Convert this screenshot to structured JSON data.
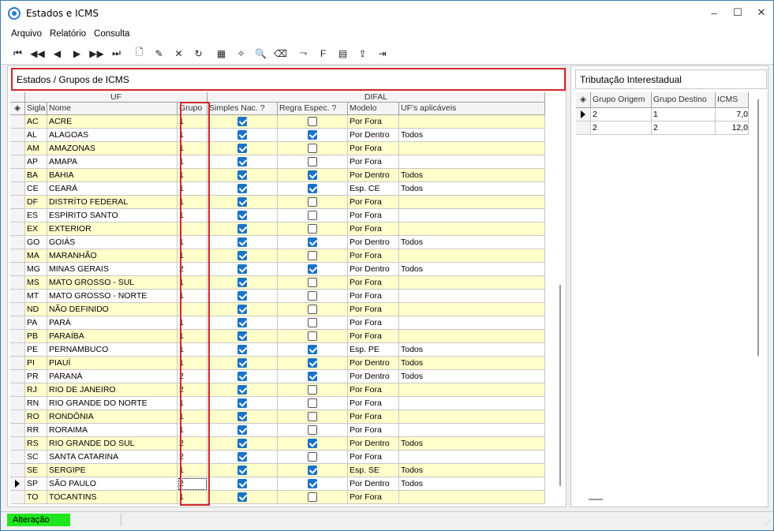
{
  "window": {
    "title": "Estados e ICMS",
    "minimize": "–",
    "maximize": "☐",
    "close": "✕"
  },
  "menu": [
    "Arquivo",
    "Relatório",
    "Consulta"
  ],
  "toolbar": [
    "first-icon",
    "prior-page-icon",
    "prior-icon",
    "next-icon",
    "next-page-icon",
    "last-icon",
    "new-document-icon",
    "edit-icon",
    "delete-icon",
    "refresh-icon",
    "print-setup-icon",
    "magic-wand-icon",
    "print-preview-icon",
    "eraser-icon",
    "goto-icon",
    "filter-icon",
    "report-icon",
    "export-icon",
    "exit-icon"
  ],
  "toolbar_glyphs": [
    "⏮",
    "◀◀",
    "◀",
    "▶",
    "▶▶",
    "⏭",
    "🗋",
    "✎",
    "✕",
    "↻",
    "▦",
    "✧",
    "🔍",
    "⌫",
    "⤳",
    "F",
    "▤",
    "⇪",
    "⇥"
  ],
  "left_panel": {
    "title": "Estados / Grupos de ICMS"
  },
  "grid": {
    "band_uf": "UF",
    "band_difal": "DIFAL",
    "columns": [
      "Sigla",
      "Nome",
      "Grupo",
      "Simples Nac. ?",
      "Regra Espec. ?",
      "Modelo",
      "UF's aplicáveis"
    ],
    "rows": [
      {
        "sigla": "AC",
        "nome": "ACRE",
        "grupo": "1",
        "simples": true,
        "regra": false,
        "modelo": "Por Fora",
        "ufs": ""
      },
      {
        "sigla": "AL",
        "nome": "ALAGOAS",
        "grupo": "1",
        "simples": true,
        "regra": true,
        "modelo": "Por Dentro",
        "ufs": "Todos"
      },
      {
        "sigla": "AM",
        "nome": "AMAZONAS",
        "grupo": "1",
        "simples": true,
        "regra": false,
        "modelo": "Por Fora",
        "ufs": ""
      },
      {
        "sigla": "AP",
        "nome": "AMAPA",
        "grupo": "1",
        "simples": true,
        "regra": false,
        "modelo": "Por Fora",
        "ufs": ""
      },
      {
        "sigla": "BA",
        "nome": "BAHIA",
        "grupo": "1",
        "simples": true,
        "regra": true,
        "modelo": "Por Dentro",
        "ufs": "Todos"
      },
      {
        "sigla": "CE",
        "nome": "CEARÁ",
        "grupo": "1",
        "simples": true,
        "regra": true,
        "modelo": "Esp. CE",
        "ufs": "Todos"
      },
      {
        "sigla": "DF",
        "nome": "DISTRÍTO FEDERAL",
        "grupo": "1",
        "simples": true,
        "regra": false,
        "modelo": "Por Fora",
        "ufs": ""
      },
      {
        "sigla": "ES",
        "nome": "ESPÍRITO SANTO",
        "grupo": "1",
        "simples": true,
        "regra": false,
        "modelo": "Por Fora",
        "ufs": ""
      },
      {
        "sigla": "EX",
        "nome": "EXTERIOR",
        "grupo": "",
        "simples": true,
        "regra": false,
        "modelo": "Por Fora",
        "ufs": ""
      },
      {
        "sigla": "GO",
        "nome": "GOIÁS",
        "grupo": "1",
        "simples": true,
        "regra": true,
        "modelo": "Por Dentro",
        "ufs": "Todos"
      },
      {
        "sigla": "MA",
        "nome": "MARANHÃO",
        "grupo": "1",
        "simples": true,
        "regra": false,
        "modelo": "Por Fora",
        "ufs": ""
      },
      {
        "sigla": "MG",
        "nome": "MINAS GERAIS",
        "grupo": "2",
        "simples": true,
        "regra": true,
        "modelo": "Por Dentro",
        "ufs": "Todos"
      },
      {
        "sigla": "MS",
        "nome": "MATO GROSSO - SUL",
        "grupo": "1",
        "simples": true,
        "regra": false,
        "modelo": "Por Fora",
        "ufs": ""
      },
      {
        "sigla": "MT",
        "nome": "MATO GROSSO - NORTE",
        "grupo": "1",
        "simples": true,
        "regra": false,
        "modelo": "Por Fora",
        "ufs": ""
      },
      {
        "sigla": "ND",
        "nome": "NÃO DEFINIDO",
        "grupo": "",
        "simples": true,
        "regra": false,
        "modelo": "Por Fora",
        "ufs": ""
      },
      {
        "sigla": "PA",
        "nome": "PARÁ",
        "grupo": "1",
        "simples": true,
        "regra": false,
        "modelo": "Por Fora",
        "ufs": ""
      },
      {
        "sigla": "PB",
        "nome": "PARAÍBA",
        "grupo": "1",
        "simples": true,
        "regra": false,
        "modelo": "Por Fora",
        "ufs": ""
      },
      {
        "sigla": "PE",
        "nome": "PERNAMBUCO",
        "grupo": "1",
        "simples": true,
        "regra": true,
        "modelo": "Esp. PE",
        "ufs": "Todos"
      },
      {
        "sigla": "PI",
        "nome": "PIAUÍ",
        "grupo": "1",
        "simples": true,
        "regra": true,
        "modelo": "Por Dentro",
        "ufs": "Todos"
      },
      {
        "sigla": "PR",
        "nome": "PARANÁ",
        "grupo": "2",
        "simples": true,
        "regra": true,
        "modelo": "Por Dentro",
        "ufs": "Todos"
      },
      {
        "sigla": "RJ",
        "nome": "RIO DE JANEIRO",
        "grupo": "2",
        "simples": true,
        "regra": false,
        "modelo": "Por Fora",
        "ufs": ""
      },
      {
        "sigla": "RN",
        "nome": "RIO GRANDE DO NORTE",
        "grupo": "1",
        "simples": true,
        "regra": false,
        "modelo": "Por Fora",
        "ufs": ""
      },
      {
        "sigla": "RO",
        "nome": "RONDÔNIA",
        "grupo": "1",
        "simples": true,
        "regra": false,
        "modelo": "Por Fora",
        "ufs": ""
      },
      {
        "sigla": "RR",
        "nome": "RORAIMA",
        "grupo": "1",
        "simples": true,
        "regra": false,
        "modelo": "Por Fora",
        "ufs": ""
      },
      {
        "sigla": "RS",
        "nome": "RIO GRANDE DO SUL",
        "grupo": "2",
        "simples": true,
        "regra": true,
        "modelo": "Por Dentro",
        "ufs": "Todos"
      },
      {
        "sigla": "SC",
        "nome": "SANTA CATARINA",
        "grupo": "2",
        "simples": true,
        "regra": false,
        "modelo": "Por Fora",
        "ufs": ""
      },
      {
        "sigla": "SE",
        "nome": "SERGIPE",
        "grupo": "1",
        "simples": true,
        "regra": true,
        "modelo": "Esp. SE",
        "ufs": "Todos"
      },
      {
        "sigla": "SP",
        "nome": "SÃO PAULO",
        "grupo": "2",
        "simples": true,
        "regra": true,
        "modelo": "Por Dentro",
        "ufs": "Todos",
        "current": true
      },
      {
        "sigla": "TO",
        "nome": "TOCANTINS",
        "grupo": "1",
        "simples": true,
        "regra": false,
        "modelo": "Por Fora",
        "ufs": ""
      }
    ]
  },
  "right_panel": {
    "title": "Tributação Interestadual",
    "columns": [
      "Grupo Origem",
      "Grupo Destino",
      "ICMS"
    ],
    "rows": [
      {
        "origem": "2",
        "destino": "1",
        "icms": "7,0",
        "current": true
      },
      {
        "origem": "2",
        "destino": "2",
        "icms": "12,0"
      }
    ]
  },
  "status": {
    "mode": "Alteração"
  },
  "colors": {
    "highlight_row": "#ffffcc",
    "status_green": "#1ee61e",
    "red_frame": "#d0272a",
    "checkbox_blue": "#1a73c9"
  }
}
